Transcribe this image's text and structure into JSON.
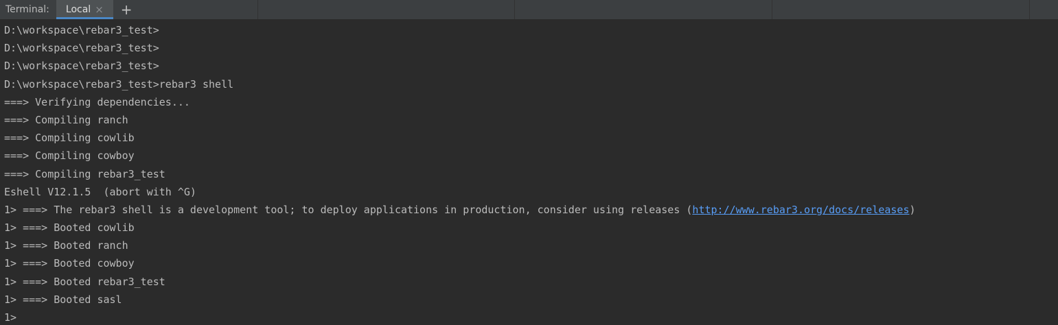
{
  "tabbar": {
    "title": "Terminal:",
    "tabs": [
      {
        "label": "Local"
      }
    ],
    "close_glyph": "×",
    "add_glyph": "+"
  },
  "terminal": {
    "lines": [
      "D:\\workspace\\rebar3_test>",
      "D:\\workspace\\rebar3_test>",
      "D:\\workspace\\rebar3_test>",
      "D:\\workspace\\rebar3_test>rebar3 shell",
      "===> Verifying dependencies...",
      "===> Compiling ranch",
      "===> Compiling cowlib",
      "===> Compiling cowboy",
      "===> Compiling rebar3_test",
      "Eshell V12.1.5  (abort with ^G)",
      {
        "before": "1> ===> The rebar3 shell is a development tool; to deploy applications in production, consider using releases (",
        "link": "http://www.rebar3.org/docs/releases",
        "after": ")"
      },
      "1> ===> Booted cowlib",
      "1> ===> Booted ranch",
      "1> ===> Booted cowboy",
      "1> ===> Booted rebar3_test",
      "1> ===> Booted sasl",
      "1>"
    ]
  },
  "colors": {
    "background": "#2b2b2b",
    "tabbar": "#3c3f41",
    "text": "#bbbbbb",
    "link": "#589df6",
    "active_tab_underline": "#4a88c7"
  }
}
